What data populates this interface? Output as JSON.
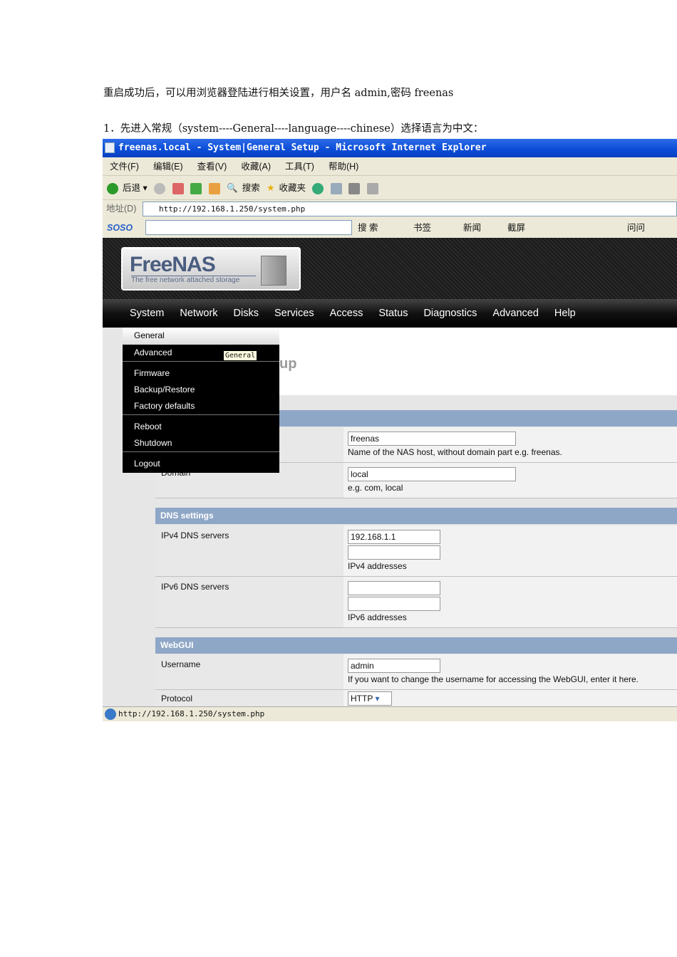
{
  "doc": {
    "line1": "重启成功后，可以用浏览器登陆进行相关设置，用户名 admin,密码 freenas",
    "line2": "1．先进入常规（system----General----language----chinese）选择语言为中文："
  },
  "browser": {
    "title": "freenas.local - System|General Setup - Microsoft Internet Explorer",
    "menu": [
      "文件(F)",
      "编辑(E)",
      "查看(V)",
      "收藏(A)",
      "工具(T)",
      "帮助(H)"
    ],
    "toolbar": {
      "back": "后退",
      "search": "搜索",
      "favorites": "收藏夹"
    },
    "address_label": "地址(D)",
    "url": "http://192.168.1.250/system.php",
    "soso": {
      "logo": "SOSO",
      "search_button": "搜 索",
      "bookmarks": "书签",
      "news": "新闻",
      "screenshot": "截屏",
      "ask": "问问"
    },
    "status_url": "http://192.168.1.250/system.php"
  },
  "freenas": {
    "logo": "FreeNAS",
    "tagline": "The free network attached storage",
    "nav": [
      "System",
      "Network",
      "Disks",
      "Services",
      "Access",
      "Status",
      "Diagnostics",
      "Advanced",
      "Help"
    ],
    "dropdown": [
      "General",
      "Advanced",
      "Firmware",
      "Backup/Restore",
      "Factory defaults",
      "Reboot",
      "Shutdown",
      "Logout"
    ],
    "tooltip": "General",
    "page_title_partial": "up",
    "hostname": {
      "value": "freenas",
      "hint": "Name of the NAS host, without domain part e.g. freenas."
    },
    "domain": {
      "label": "Domain",
      "value": "local",
      "hint": "e.g. com, local"
    },
    "dns": {
      "header": "DNS settings",
      "ipv4_label": "IPv4 DNS servers",
      "ipv4_value": "192.168.1.1",
      "ipv4_hint": "IPv4 addresses",
      "ipv6_label": "IPv6 DNS servers",
      "ipv6_hint": "IPv6 addresses"
    },
    "webgui": {
      "header": "WebGUI",
      "username_label": "Username",
      "username_value": "admin",
      "username_hint": "If you want to change the username for accessing the WebGUI, enter it here.",
      "protocol_label": "Protocol",
      "protocol_value": "HTTP"
    }
  }
}
